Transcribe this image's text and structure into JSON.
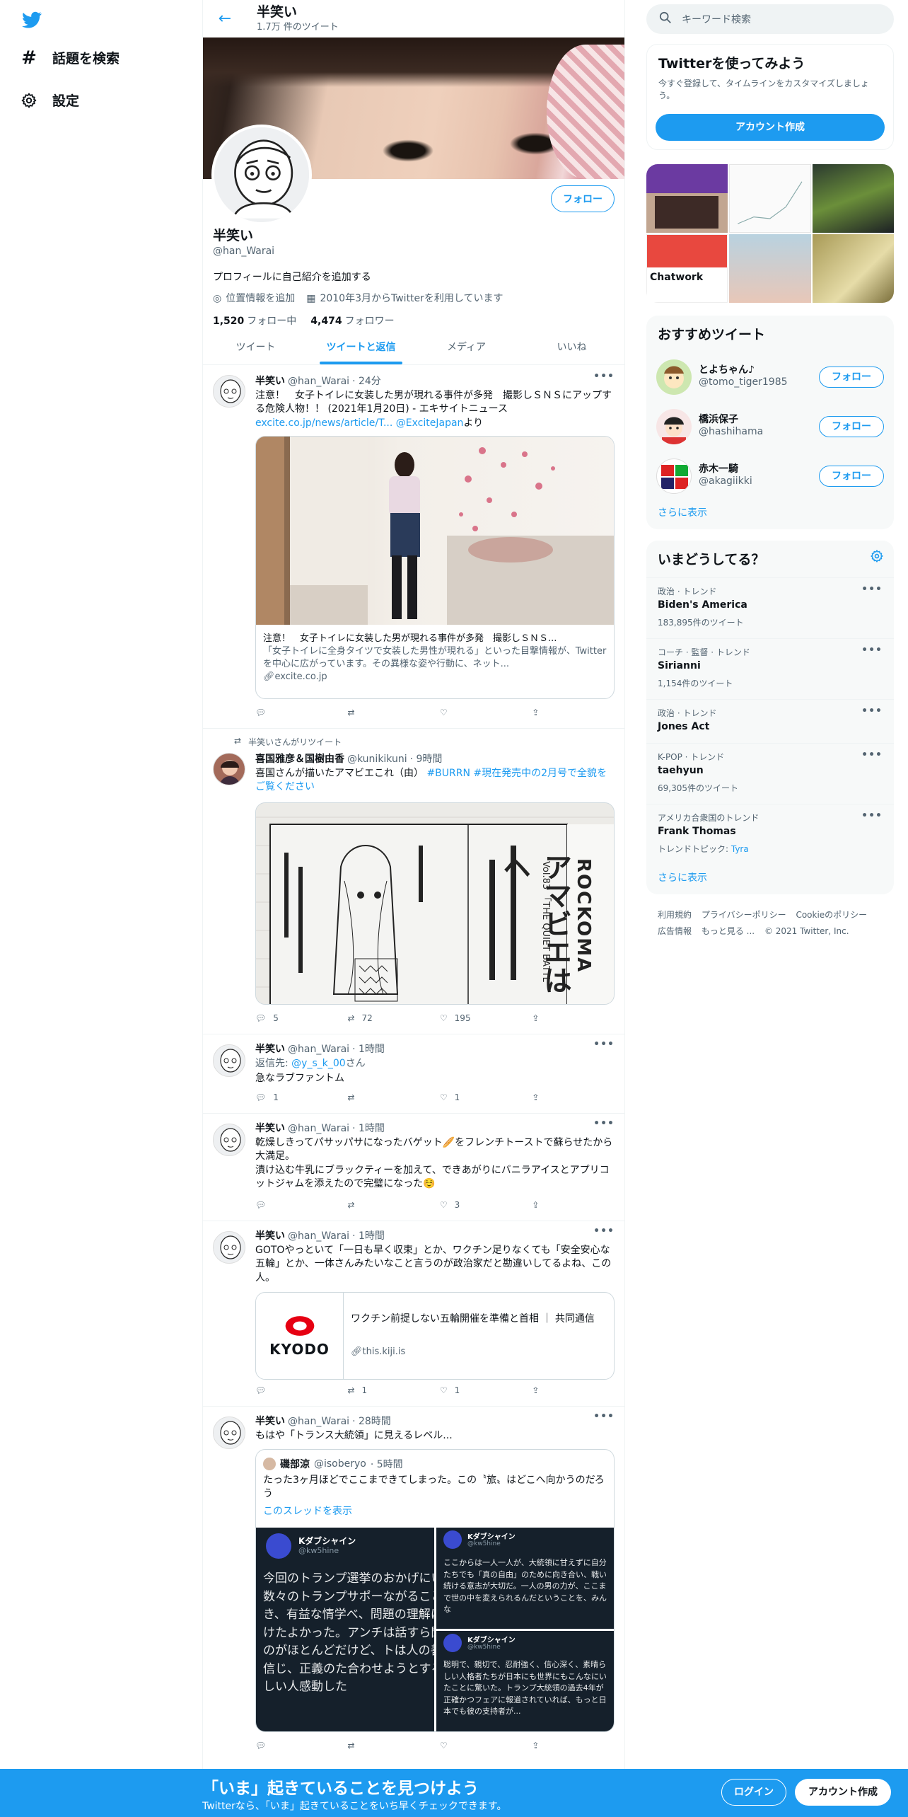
{
  "nav": {
    "explore": "話題を検索",
    "settings": "設定"
  },
  "header": {
    "name": "半笑い",
    "tweet_count": "1.7万 件のツイート"
  },
  "profile": {
    "follow": "フォロー",
    "name": "半笑い",
    "handle": "@han_Warai",
    "bio": "プロフィールに自己紹介を追加する",
    "location": "位置情報を追加",
    "joined": "2010年3月からTwitterを利用しています",
    "following_count": "1,520",
    "following_label": "フォロー中",
    "followers_count": "4,474",
    "followers_label": "フォロワー"
  },
  "tabs": [
    "ツイート",
    "ツイートと返信",
    "メディア",
    "いいね"
  ],
  "tweets": [
    {
      "name": "半笑い",
      "handle": "@han_Warai",
      "time": "· 24分",
      "text": "注意！　女子トイレに女装した男が現れる事件が多発　撮影しＳＮＳにアップする危険人物！！ (2021年1月20日) - エキサイトニュース",
      "link": "excite.co.jp/news/article/T...",
      "mention": "@ExciteJapan",
      "suffix": "より",
      "card_title": "注意！　女子トイレに女装した男が現れる事件が多発　撮影しＳＮＳ...",
      "card_desc": "「女子トイレに全身タイツで女装した男性が現れる」といった目撃情報が、Twitterを中心に広がっています。その異様な姿や行動に、ネット...",
      "card_domain": "excite.co.jp"
    },
    {
      "retweet_label": "半笑いさんがリツイート",
      "name": "喜国雅彦＆国樹由香",
      "handle": "@kunikikuni",
      "time": "· 9時間",
      "text": "喜国さんが描いたアマビエこれ（由）",
      "hashtags": "#BURRN #現在発売中の2月号で全貌をご覧ください",
      "manga_header": "ROCKOMA",
      "manga_sub": "Vol.83 「THE QUIET BATTL",
      "manga_title": "アマビエはヘ",
      "replies": "5",
      "retweets": "72",
      "likes": "195"
    },
    {
      "name": "半笑い",
      "handle": "@han_Warai",
      "time": "· 1時間",
      "reply_prefix": "返信先: ",
      "reply_to": "@y_s_k_00",
      "reply_suffix": "さん",
      "text": "急なラブファントム",
      "replies": "1",
      "likes": "1"
    },
    {
      "name": "半笑い",
      "handle": "@han_Warai",
      "time": "· 1時間",
      "text1": "乾燥しきってパサッパサになったバゲット🥖をフレンチトーストで蘇らせたから大満足。",
      "text2": "漬け込む牛乳にブラックティーを加えて、できあがりにバニラアイスとアプリコットジャムを添えたので完璧になった☺️",
      "likes": "3"
    },
    {
      "name": "半笑い",
      "handle": "@han_Warai",
      "time": "· 1時間",
      "text": "GOTOやっといて「一日も早く収束」とか、ワクチン足りなくても「安全安心な五輪」とか、一体さんみたいなこと言うのが政治家だと勘違いしてるよね、この人。",
      "card_logo": "KYODO",
      "card_title": "ワクチン前提しない五輪開催を準備と首相 ｜ 共同通信",
      "card_domain": "this.kiji.is",
      "retweets": "1",
      "likes": "1"
    },
    {
      "name": "半笑い",
      "handle": "@han_Warai",
      "time": "· 28時間",
      "text": "もはや「トランス大統領」に見えるレベル...",
      "quote_name": "磯部涼",
      "quote_handle": "@isoberyo",
      "quote_time": "· 5時間",
      "quote_text": "たった3ヶ月ほどでここまできてしまった。この〝旅〟はどこへ向かうのだろう",
      "quote_thread": "このスレッドを表示",
      "img_name": "Kダブシャイン",
      "img_handle": "@kw5hine",
      "img1_text": "今回のトランプ選挙のおかげにいる数々のトランプサポーながることができ、有益な情学べ、問題の理解に近づけたよかった。アンチは話すら聞ないのがほとんどだけど、トは人の善意を信じ、正義のた合わせようとする心優しい人感動した",
      "img2_text": "ここからは一人一人が、大統領に甘えずに自分たちでも「真の自由」のために向き合い、戦い続ける意志が大切だ。一人の男の力が、ここまで世の中を変えられるんだということを、みんな",
      "img3_text": "聡明で、親切で、忍耐強く、信心深く、素晴らしい人格者たちが日本にも世界にもこんなにいたことに驚いた。トランプ大統領の過去4年が正確かつフェアに報道されていれば、もっと日本でも彼の支持者が..."
    }
  ],
  "right": {
    "search_placeholder": "キーワード検索",
    "signup_title": "Twitterを使ってみよう",
    "signup_desc": "今すぐ登録して、タイムラインをカスタマイズしましょう。",
    "signup_button": "アカウント作成",
    "grid_label_chatwork": "Chatwork",
    "recommend_title": "おすすめツイート",
    "recommend": [
      {
        "name": "とよちゃん♪",
        "handle": "@tomo_tiger1985",
        "button": "フォロー"
      },
      {
        "name": "橋浜保子",
        "handle": "@hashihama",
        "button": "フォロー"
      },
      {
        "name": "赤木一騎",
        "handle": "@akagiikki",
        "button": "フォロー"
      }
    ],
    "more": "さらに表示",
    "trends_title": "いまどうしてる？",
    "trends": [
      {
        "category": "政治 · トレンド",
        "name": "Biden's America",
        "count": "183,895件のツイート"
      },
      {
        "category": "コーチ · 監督 · トレンド",
        "name": "Sirianni",
        "count": "1,154件のツイート"
      },
      {
        "category": "政治 · トレンド",
        "name": "Jones Act",
        "count": ""
      },
      {
        "category": "K-POP · トレンド",
        "name": "taehyun",
        "count": "69,305件のツイート"
      },
      {
        "category": "アメリカ合衆国のトレンド",
        "name": "Frank Thomas",
        "count": "トレンドトピック: ",
        "topic": "Tyra"
      }
    ],
    "trends_more": "さらに表示",
    "footer": {
      "terms": "利用規約",
      "privacy": "プライバシーポリシー",
      "cookie": "Cookieのポリシー",
      "ads": "広告情報",
      "more": "もっと見る ...",
      "copyright": "© 2021 Twitter, Inc."
    }
  },
  "bottom": {
    "title": "「いま」起きていることを見つけよう",
    "subtitle": "Twitterなら、「いま」起きていることをいち早くチェックできます。",
    "login": "ログイン",
    "signup": "アカウント作成"
  },
  "colors": {
    "accent": "#1d9bf0",
    "text": "#0f1419",
    "muted": "#536471"
  }
}
